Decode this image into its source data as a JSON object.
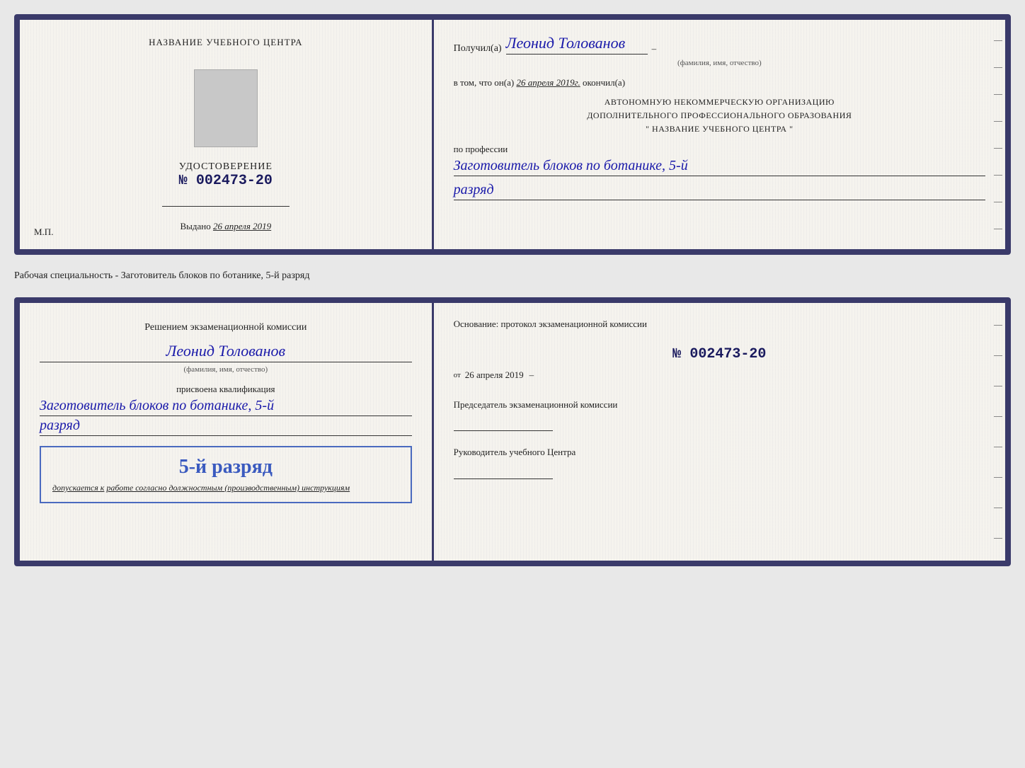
{
  "page": {
    "background": "#e8e8e8"
  },
  "cert1": {
    "left": {
      "org_name": "НАЗВАНИЕ УЧЕБНОГО ЦЕНТРА",
      "title": "УДОСТОВЕРЕНИЕ",
      "number_prefix": "№",
      "number": "002473-20",
      "issued_label": "Выдано",
      "issued_date": "26 апреля 2019",
      "mp_label": "М.П."
    },
    "right": {
      "recipient_prefix": "Получил(а)",
      "recipient_name": "Леонид Толованов",
      "recipient_subtext": "(фамилия, имя, отчество)",
      "certified_prefix": "в том, что он(а)",
      "certified_date": "26 апреля 2019г.",
      "certified_suffix": "окончил(а)",
      "org_line1": "АВТОНОМНУЮ НЕКОММЕРЧЕСКУЮ ОРГАНИЗАЦИЮ",
      "org_line2": "ДОПОЛНИТЕЛЬНОГО ПРОФЕССИОНАЛЬНОГО ОБРАЗОВАНИЯ",
      "org_line3": "\" НАЗВАНИЕ УЧЕБНОГО ЦЕНТРА \"",
      "profession_label": "по профессии",
      "profession_name": "Заготовитель блоков по ботанике, 5-й",
      "rank": "разряд"
    }
  },
  "info_text": "Рабочая специальность - Заготовитель блоков по ботанике, 5-й разряд",
  "cert2": {
    "left": {
      "heading": "Решением экзаменационной комиссии",
      "name": "Леонид Толованов",
      "name_subtext": "(фамилия, имя, отчество)",
      "qualification_label": "присвоена квалификация",
      "qualification_name": "Заготовитель блоков по ботанике, 5-й",
      "rank": "разряд",
      "stamp_rank": "5-й разряд",
      "stamp_admission": "допускается к",
      "stamp_admission_italic": "работе согласно должностным (производственным) инструкциям"
    },
    "right": {
      "basis_label": "Основание: протокол экзаменационной комиссии",
      "protocol_prefix": "№",
      "protocol_number": "002473-20",
      "date_prefix": "от",
      "date_superscript": "от",
      "date": "26 апреля 2019",
      "chairman_title": "Председатель экзаменационной комиссии",
      "director_title": "Руководитель учебного Центра"
    }
  }
}
